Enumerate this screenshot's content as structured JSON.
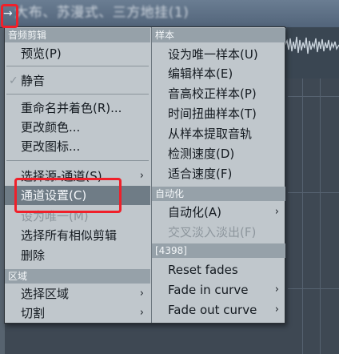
{
  "background": {
    "clip_title": "大布、苏漫式、三方地挂(1)",
    "clip_arrow": "→"
  },
  "menu_left": {
    "header_audio_clip": "音频剪辑",
    "preview": "预览(P)",
    "mute": "静音",
    "rename_color": "重命名并着色(R)...",
    "change_color": "更改颜色...",
    "change_icon": "更改图标...",
    "select_source_channel": "选择源-通道(S)",
    "channel_settings": "通道设置(C)",
    "make_unique": "设为唯一(M)",
    "select_all_similar": "选择所有相似剪辑",
    "delete": "删除",
    "header_region": "区域",
    "select_region": "选择区域",
    "slice": "切割"
  },
  "menu_right": {
    "header_sample": "样本",
    "make_unique_sample": "设为唯一样本(U)",
    "edit_sample": "编辑样本(E)",
    "pitch_correct_sample": "音高校正样本(P)",
    "time_warp_sample": "时间扭曲样本(T)",
    "extract_tracks": "从样本提取音轨",
    "detect_tempo": "检测速度(D)",
    "fit_tempo": "适合速度(F)",
    "header_automation": "自动化",
    "automation": "自动化(A)",
    "crossfade": "交叉淡入淡出(F)",
    "header_4398": "[4398]",
    "reset_fades": "Reset fades",
    "fade_in_curve": "Fade in curve",
    "fade_out_curve": "Fade out curve"
  },
  "icons": {
    "submenu_arrow": "›",
    "check": "✓"
  },
  "colors": {
    "menu_bg": "#c0c7cc",
    "section_header_bg": "#96a1a9",
    "selected_bg": "#6f7c86",
    "highlight_red": "#f0202a"
  }
}
